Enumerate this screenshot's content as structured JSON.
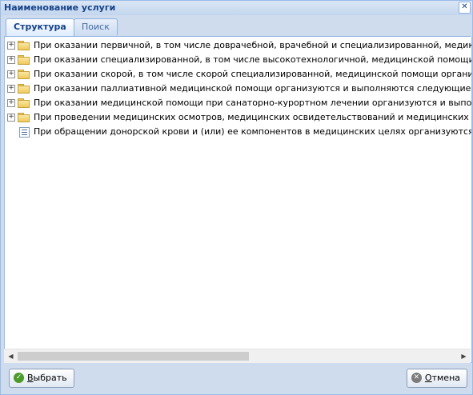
{
  "window": {
    "title": "Наименование услуги",
    "close_glyph": "✕"
  },
  "tabs": [
    {
      "label": "Структура",
      "active": true
    },
    {
      "label": "Поиск",
      "active": false
    }
  ],
  "tree": {
    "items": [
      {
        "type": "folder",
        "expander": "+",
        "label": "При оказании первичной, в том числе доврачебной, врачебной и специализированной, медико-санитарной"
      },
      {
        "type": "folder",
        "expander": "+",
        "label": "При оказании специализированной, в том числе высокотехнологичной, медицинской помощи организуются"
      },
      {
        "type": "folder",
        "expander": "+",
        "label": "При оказании скорой, в том числе скорой специализированной, медицинской помощи организуются и выпо"
      },
      {
        "type": "folder",
        "expander": "+",
        "label": "При оказании паллиативной медицинской помощи организуются и выполняются следующие работы (услуг"
      },
      {
        "type": "folder",
        "expander": "+",
        "label": "При оказании медицинской помощи при санаторно-курортном лечении организуются и выполняются работ"
      },
      {
        "type": "folder",
        "expander": "+",
        "label": "При проведении медицинских осмотров, медицинских освидетельствований и медицинских экспертиз орг"
      },
      {
        "type": "leaf",
        "expander": "",
        "label": "При обращении донорской крови и (или) ее компонентов в медицинских целях организуются и выполняют"
      }
    ]
  },
  "scrollbar": {
    "left_arrow": "◀",
    "right_arrow": "▶"
  },
  "buttons": {
    "select": {
      "label_first": "В",
      "label_rest": "ыбрать",
      "icon": "check-icon",
      "glyph": "✓"
    },
    "cancel": {
      "label_first": "О",
      "label_rest": "тмена",
      "icon": "cancel-icon",
      "glyph": "✕"
    }
  },
  "colors": {
    "title_text": "#15428b",
    "frame": "#cfdcee",
    "border": "#99bbe8"
  }
}
